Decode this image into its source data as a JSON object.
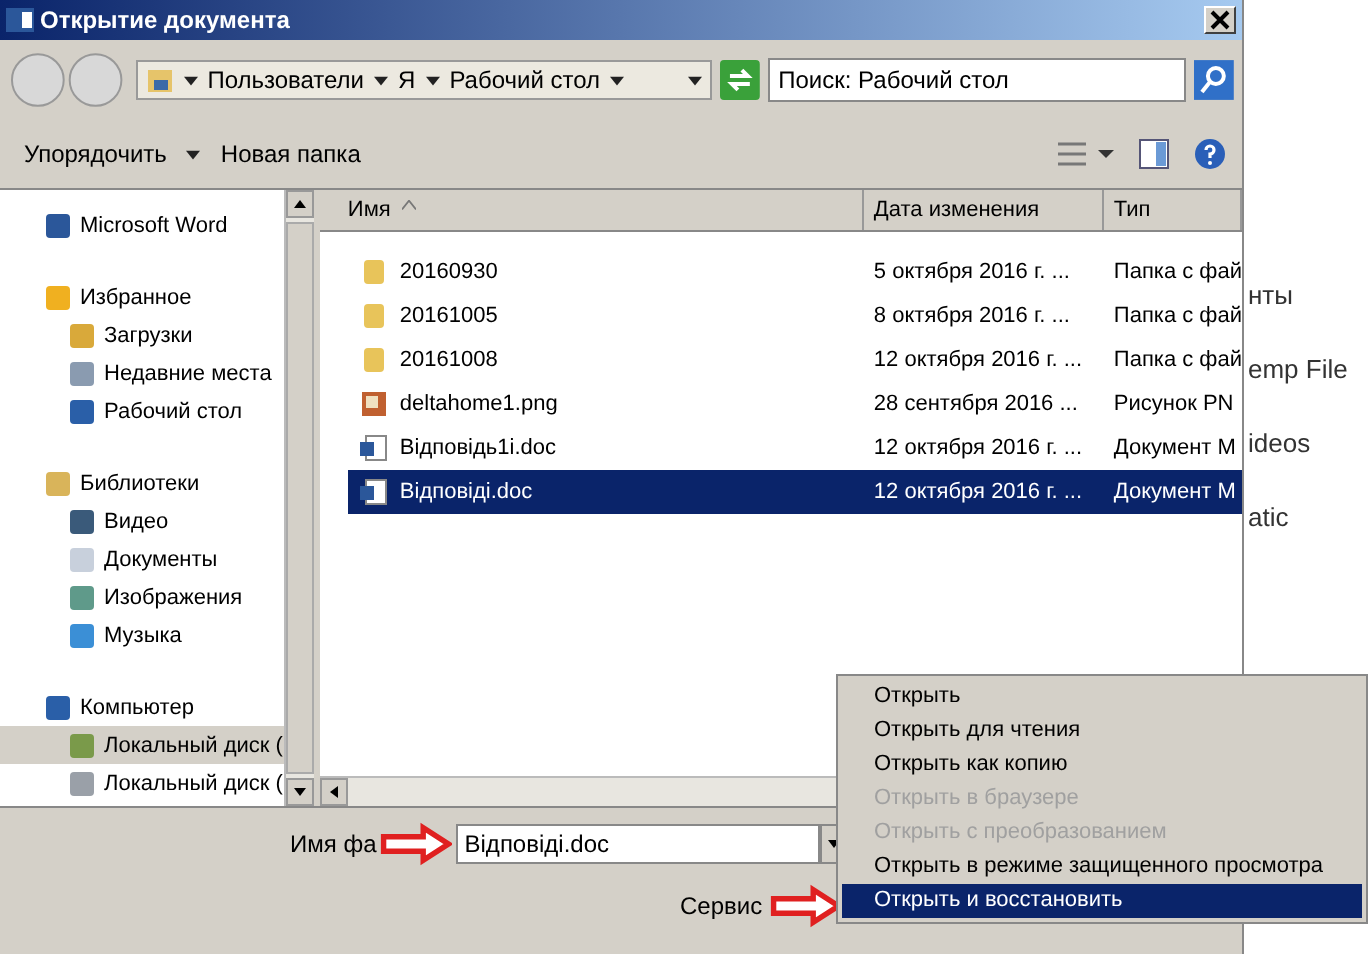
{
  "window": {
    "title": "Открытие документа"
  },
  "breadcrumb": [
    "Пользователи",
    "Я",
    "Рабочий стол"
  ],
  "search": {
    "placeholder": "Поиск: Рабочий стол"
  },
  "toolbar": {
    "organize": "Упорядочить",
    "new_folder": "Новая папка"
  },
  "sidebar": {
    "items": [
      {
        "label": "Microsoft Word",
        "selected": false
      },
      {
        "label": "Избранное",
        "selected": false,
        "children": [
          {
            "label": "Загрузки",
            "selected": false
          },
          {
            "label": "Недавние места",
            "selected": false
          },
          {
            "label": "Рабочий стол",
            "selected": false
          }
        ]
      },
      {
        "label": "Библиотеки",
        "selected": false,
        "children": [
          {
            "label": "Видео",
            "selected": false
          },
          {
            "label": "Документы",
            "selected": false
          },
          {
            "label": "Изображения",
            "selected": false
          },
          {
            "label": "Музыка",
            "selected": false
          }
        ]
      },
      {
        "label": "Компьютер",
        "selected": false,
        "children": [
          {
            "label": "Локальный диск (",
            "selected": true
          },
          {
            "label": "Локальный диск (",
            "selected": false
          }
        ]
      }
    ]
  },
  "table": {
    "columns": [
      "Имя",
      "Дата изменения",
      "Тип"
    ],
    "rows": [
      {
        "name": "20160930",
        "kind": "folder",
        "date": "5 октября 2016 г. ...",
        "type": "Папка с фай",
        "selected": false
      },
      {
        "name": "20161005",
        "kind": "folder",
        "date": "8 октября 2016 г. ...",
        "type": "Папка с фай",
        "selected": false
      },
      {
        "name": "20161008",
        "kind": "folder",
        "date": "12 октября 2016 г. ...",
        "type": "Папка с фай",
        "selected": false
      },
      {
        "name": "deltahome1.png",
        "kind": "image",
        "date": "28 сентября 2016 ...",
        "type": "Рисунок PN",
        "selected": false
      },
      {
        "name": "Відповідь1i.doc",
        "kind": "doc",
        "date": "12 октября 2016 г. ...",
        "type": "Документ M",
        "selected": false
      },
      {
        "name": "Відповіді.doc",
        "kind": "doc",
        "date": "12 октября 2016 г. ...",
        "type": "Документ M",
        "selected": true
      }
    ]
  },
  "filename": {
    "label": "Имя фа",
    "value": "Відповіді.doc"
  },
  "service": {
    "label": "Сервис"
  },
  "menu": [
    {
      "label": "Открыть",
      "disabled": false,
      "selected": false
    },
    {
      "label": "Открыть для чтения",
      "disabled": false,
      "selected": false
    },
    {
      "label": "Открыть как копию",
      "disabled": false,
      "selected": false
    },
    {
      "label": "Открыть в браузере",
      "disabled": true,
      "selected": false
    },
    {
      "label": "Открыть с преобразованием",
      "disabled": true,
      "selected": false
    },
    {
      "label": "Открыть в режиме защищенного просмотра",
      "disabled": false,
      "selected": false
    },
    {
      "label": "Открыть и восстановить",
      "disabled": false,
      "selected": true
    }
  ],
  "background_texts": [
    "нты",
    "emp File",
    "ideos",
    "atic"
  ]
}
